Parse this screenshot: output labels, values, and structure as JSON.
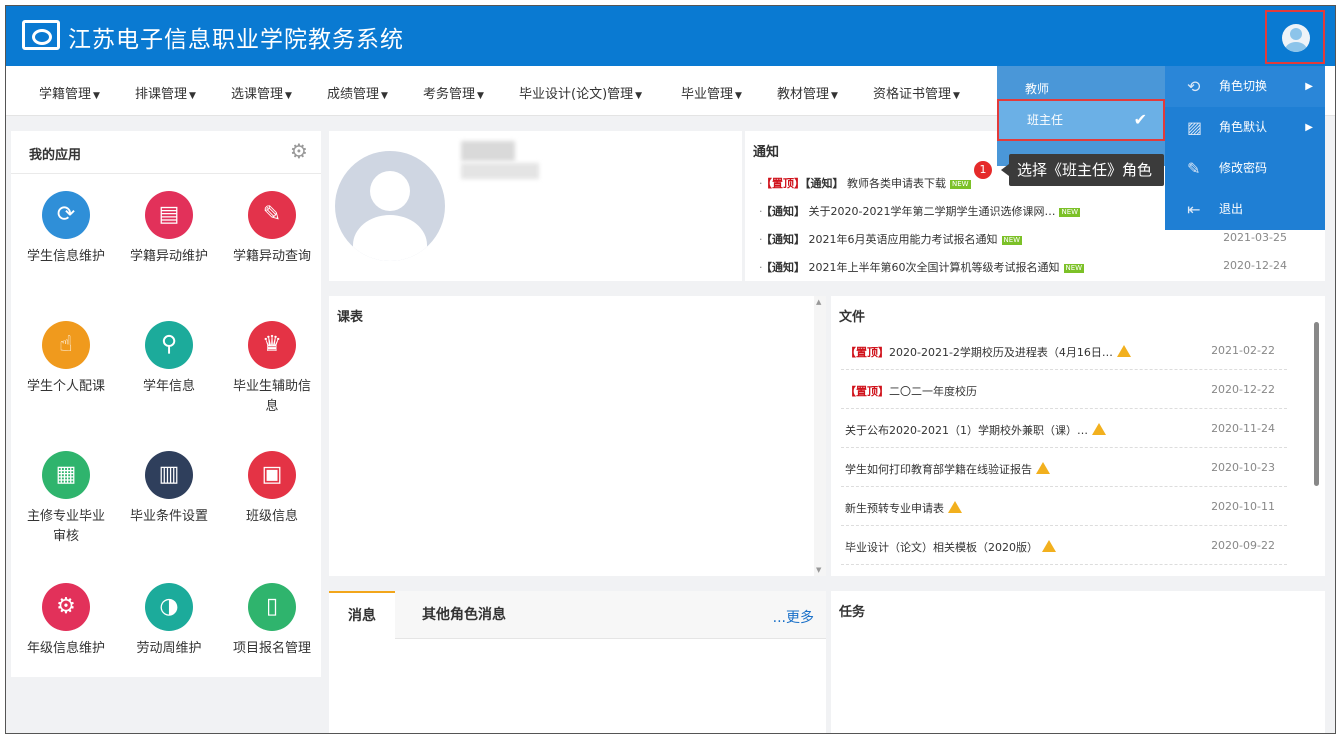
{
  "header": {
    "title": "江苏电子信息职业学院教务系统"
  },
  "nav": [
    "学籍管理",
    "排课管理",
    "选课管理",
    "成绩管理",
    "考务管理",
    "毕业设计(论文)管理",
    "毕业管理",
    "教材管理",
    "资格证书管理"
  ],
  "apps": {
    "title": "我的应用",
    "items": [
      {
        "label": "学生信息维护",
        "color": "#2f8fd8",
        "icon": "⟳"
      },
      {
        "label": "学籍异动维护",
        "color": "#e2315a",
        "icon": "▤"
      },
      {
        "label": "学籍异动查询",
        "color": "#e3334b",
        "icon": "✎"
      },
      {
        "label": "学生个人配课",
        "color": "#f09a1d",
        "icon": "☝"
      },
      {
        "label": "学年信息",
        "color": "#1cab9b",
        "icon": "⚲"
      },
      {
        "label": "毕业生辅助信息",
        "color": "#e43345",
        "icon": "♛"
      },
      {
        "label": "主修专业毕业审核",
        "color": "#2fb46d",
        "icon": "▦"
      },
      {
        "label": "毕业条件设置",
        "color": "#2f3f5c",
        "icon": "▥"
      },
      {
        "label": "班级信息",
        "color": "#e43345",
        "icon": "▣"
      },
      {
        "label": "年级信息维护",
        "color": "#e2315a",
        "icon": "⚙"
      },
      {
        "label": "劳动周维护",
        "color": "#1cab9b",
        "icon": "◑"
      },
      {
        "label": "项目报名管理",
        "color": "#2fb46d",
        "icon": "▯"
      }
    ]
  },
  "notice": {
    "title": "通知",
    "rows": [
      {
        "pin": "【置顶】",
        "tag": "【通知】",
        "text": "教师各类申请表下载",
        "date": ""
      },
      {
        "pin": "",
        "tag": "【通知】",
        "text": "关于2020-2021学年第二学期学生通识选修课网…",
        "date": ""
      },
      {
        "pin": "",
        "tag": "【通知】",
        "text": "2021年6月英语应用能力考试报名通知",
        "date": "2021-03-25"
      },
      {
        "pin": "",
        "tag": "【通知】",
        "text": "2021年上半年第60次全国计算机等级考试报名通知",
        "date": "2020-12-24"
      }
    ],
    "new_badge": "NEW"
  },
  "course": {
    "title": "课表"
  },
  "files": {
    "title": "文件",
    "rows": [
      {
        "pin": "【置顶】",
        "text": "2020-2021-2学期校历及进程表（4月16日…",
        "warn": true,
        "date": "2021-02-22"
      },
      {
        "pin": "【置顶】",
        "text": "二〇二一年度校历",
        "warn": false,
        "date": "2020-12-22"
      },
      {
        "pin": "",
        "text": "关于公布2020-2021（1）学期校外兼职（课）…",
        "warn": true,
        "date": "2020-11-24"
      },
      {
        "pin": "",
        "text": "学生如何打印教育部学籍在线验证报告",
        "warn": true,
        "date": "2020-10-23"
      },
      {
        "pin": "",
        "text": "新生预转专业申请表",
        "warn": true,
        "date": "2020-10-11"
      },
      {
        "pin": "",
        "text": "毕业设计（论文）相关模板（2020版）",
        "warn": true,
        "date": "2020-09-22"
      }
    ]
  },
  "messages": {
    "tab_active": "消息",
    "tab_other": "其他角色消息",
    "more": "...更多"
  },
  "task": {
    "title": "任务"
  },
  "roles": [
    {
      "label": "教师"
    },
    {
      "label": "班主任"
    }
  ],
  "menu": [
    {
      "label": "角色切换",
      "icon": "⟲",
      "arrow": true
    },
    {
      "label": "角色默认",
      "icon": "▨",
      "arrow": true
    },
    {
      "label": "修改密码",
      "icon": "✎",
      "arrow": false
    },
    {
      "label": "退出",
      "icon": "⇤",
      "arrow": false
    }
  ],
  "tooltip": {
    "num": "1",
    "text": "选择《班主任》角色"
  },
  "colors": {
    "brand": "#0a7ad2",
    "menu": "#1f7fd4",
    "highlight": "#e23b3b"
  }
}
